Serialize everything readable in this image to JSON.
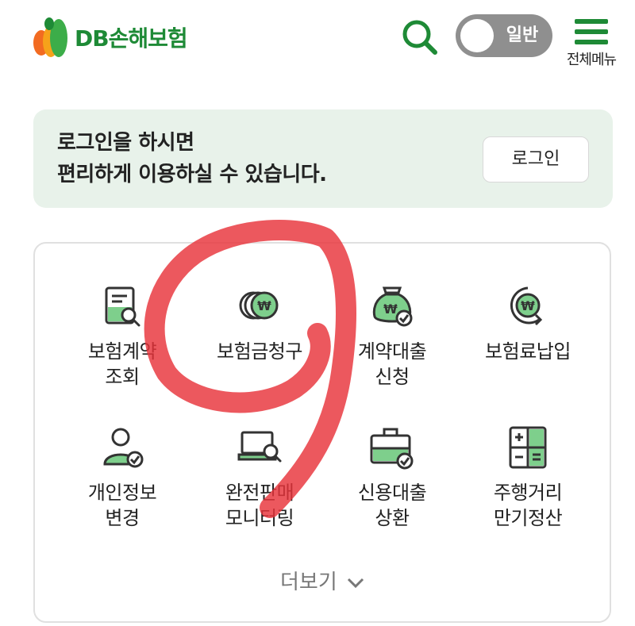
{
  "header": {
    "logo_text": "DB손해보험",
    "toggle_label": "일반",
    "menu_label": "전체메뉴"
  },
  "login_banner": {
    "line1": "로그인을 하시면",
    "line2": "편리하게 이용하실 수 있습니다.",
    "button_label": "로그인"
  },
  "services": [
    {
      "line1": "보험계약",
      "line2": "조회",
      "icon": "document-search-icon"
    },
    {
      "line1": "보험금청구",
      "line2": "",
      "icon": "coins-won-icon"
    },
    {
      "line1": "계약대출",
      "line2": "신청",
      "icon": "money-bag-icon"
    },
    {
      "line1": "보험료납입",
      "line2": "",
      "icon": "won-circle-arrow-icon"
    },
    {
      "line1": "개인정보",
      "line2": "변경",
      "icon": "user-check-icon"
    },
    {
      "line1": "완전판매",
      "line2": "모니터링",
      "icon": "laptop-search-icon"
    },
    {
      "line1": "신용대출",
      "line2": "상환",
      "icon": "briefcase-check-icon"
    },
    {
      "line1": "주행거리",
      "line2": "만기정산",
      "icon": "calculator-icon"
    }
  ],
  "more_label": "더보기",
  "colors": {
    "brand_green": "#1e8a36",
    "icon_fill_green": "#7ecf8c",
    "banner_bg": "#e8f2ea",
    "toggle_bg": "#8f8f8f",
    "annotation_red": "#e8333a"
  }
}
